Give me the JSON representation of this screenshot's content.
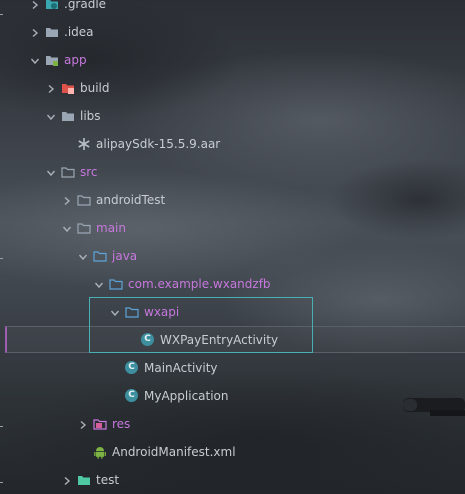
{
  "tree": [
    {
      "label": ".gradle",
      "color": "default",
      "icon": "folder-gradle-icon",
      "arrow": "right"
    },
    {
      "label": ".idea",
      "color": "default",
      "icon": "folder-icon",
      "arrow": "right"
    },
    {
      "label": "app",
      "color": "purple",
      "icon": "module-folder-icon",
      "arrow": "down"
    },
    {
      "label": "build",
      "color": "default",
      "icon": "folder-excluded-icon",
      "arrow": "right"
    },
    {
      "label": "libs",
      "color": "default",
      "icon": "folder-icon",
      "arrow": "down"
    },
    {
      "label": "alipaySdk-15.5.9.aar",
      "color": "default",
      "icon": "asterisk-file-icon",
      "arrow": "none"
    },
    {
      "label": "src",
      "color": "purple",
      "icon": "folder-outline-icon",
      "arrow": "down"
    },
    {
      "label": "androidTest",
      "color": "default",
      "icon": "folder-outline-icon",
      "arrow": "right"
    },
    {
      "label": "main",
      "color": "purple",
      "icon": "folder-outline-icon",
      "arrow": "down"
    },
    {
      "label": "java",
      "color": "purple",
      "icon": "folder-source-icon",
      "arrow": "down"
    },
    {
      "label": "com.example.wxandzfb",
      "color": "purple",
      "icon": "package-folder-icon",
      "arrow": "down"
    },
    {
      "label": "wxapi",
      "color": "purple",
      "icon": "package-folder-icon",
      "arrow": "down"
    },
    {
      "label": "WXPayEntryActivity",
      "color": "default",
      "icon": "class-icon",
      "arrow": "none"
    },
    {
      "label": "MainActivity",
      "color": "default",
      "icon": "class-icon",
      "arrow": "none"
    },
    {
      "label": "MyApplication",
      "color": "default",
      "icon": "class-icon",
      "arrow": "none"
    },
    {
      "label": "res",
      "color": "purple",
      "icon": "resource-folder-icon",
      "arrow": "right"
    },
    {
      "label": "AndroidManifest.xml",
      "color": "default",
      "icon": "android-icon",
      "arrow": "none"
    },
    {
      "label": "test",
      "color": "default",
      "icon": "folder-test-icon",
      "arrow": "right"
    }
  ],
  "class_glyph": "C",
  "colors": {
    "label_default": "#c8cdd2",
    "label_purple": "#c678dd",
    "folder": "#9aa6b4",
    "source_folder": "#5ea3d6",
    "selection_border": "#46b0b4",
    "row_highlight_border": "#9c5fb0",
    "class_icon_bg": "#3d8fa0",
    "android_green": "#7cb342",
    "excluded_red": "#e0534a",
    "test_green": "#4ec9a4"
  }
}
